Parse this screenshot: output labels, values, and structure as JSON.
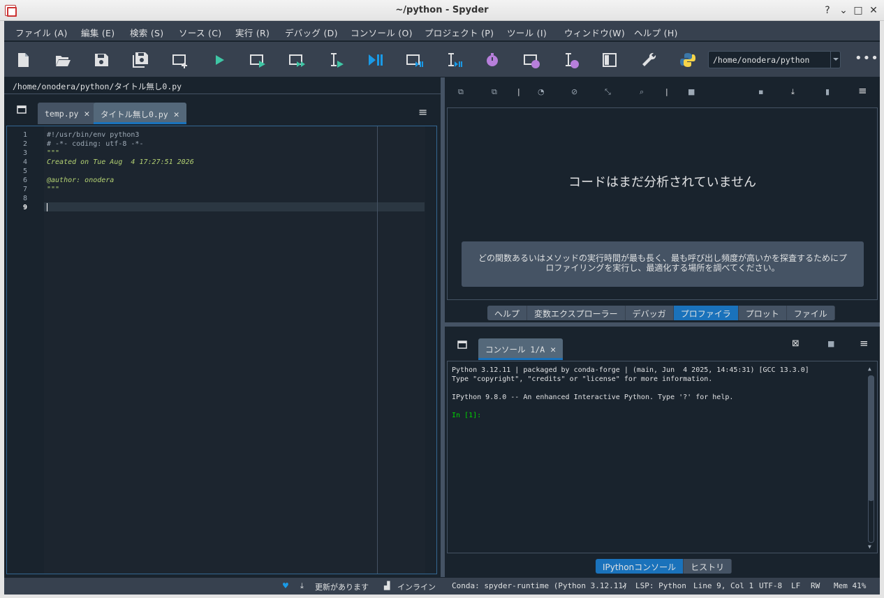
{
  "window": {
    "title": "~/python - Spyder"
  },
  "menu": [
    "ファイル (A)",
    "編集 (E)",
    "検索 (S)",
    "ソース (C)",
    "実行 (R)",
    "デバッグ (D)",
    "コンソール (O)",
    "プロジェクト (P)",
    "ツール (I)",
    "ウィンドウ(W)",
    "ヘルプ (H)"
  ],
  "toolbar": {
    "working_dir": "/home/onodera/python",
    "more": "•••"
  },
  "editor": {
    "filename": "/home/onodera/python/タイトル無し0.py",
    "tabs": [
      {
        "label": "temp.py"
      },
      {
        "label": "タイトル無し0.py"
      }
    ],
    "line_numbers": [
      "1",
      "2",
      "3",
      "4",
      "5",
      "6",
      "7",
      "8",
      "9"
    ],
    "lines": [
      "#!/usr/bin/env python3",
      "# -*- coding: utf-8 -*-",
      "\"\"\"",
      "Created on Tue Aug  4 17:27:51 2026",
      "",
      "@author: onodera",
      "\"\"\"",
      "",
      ""
    ]
  },
  "profiler": {
    "message": "コードはまだ分析されていません",
    "hint": "どの関数あるいはメソッドの実行時間が最も長く、最も呼び出し頻度が高いかを探査するためにプロファイリングを実行し、最適化する場所を調べてください。",
    "tabs": [
      "ヘルプ",
      "変数エクスプローラー",
      "デバッガ",
      "プロファイラ",
      "プロット",
      "ファイル"
    ]
  },
  "console": {
    "tab": "コンソール 1/A",
    "lines": [
      "Python 3.12.11 | packaged by conda-forge | (main, Jun  4 2025, 14:45:31) [GCC 13.3.0]",
      "Type \"copyright\", \"credits\" or \"license\" for more information.",
      "",
      "IPython 9.8.0 -- An enhanced Interactive Python. Type '?' for help.",
      "",
      "In [1]:"
    ],
    "tabs": [
      "IPythonコンソール",
      "ヒストリ"
    ]
  },
  "status": {
    "update": "更新があります",
    "inline": "インライン",
    "conda": "Conda: spyder-runtime (Python 3.12.11)",
    "lsp": "LSP: Python",
    "position": "Line 9, Col 1",
    "encoding": "UTF-8",
    "eol": "LF",
    "rw": "RW",
    "mem": "Mem 41%"
  },
  "colors": {
    "accent": "#1a72bb",
    "panel": "#37414f",
    "bg": "#19232d",
    "green_run": "#3fc6a5",
    "purple": "#b77fdb"
  }
}
